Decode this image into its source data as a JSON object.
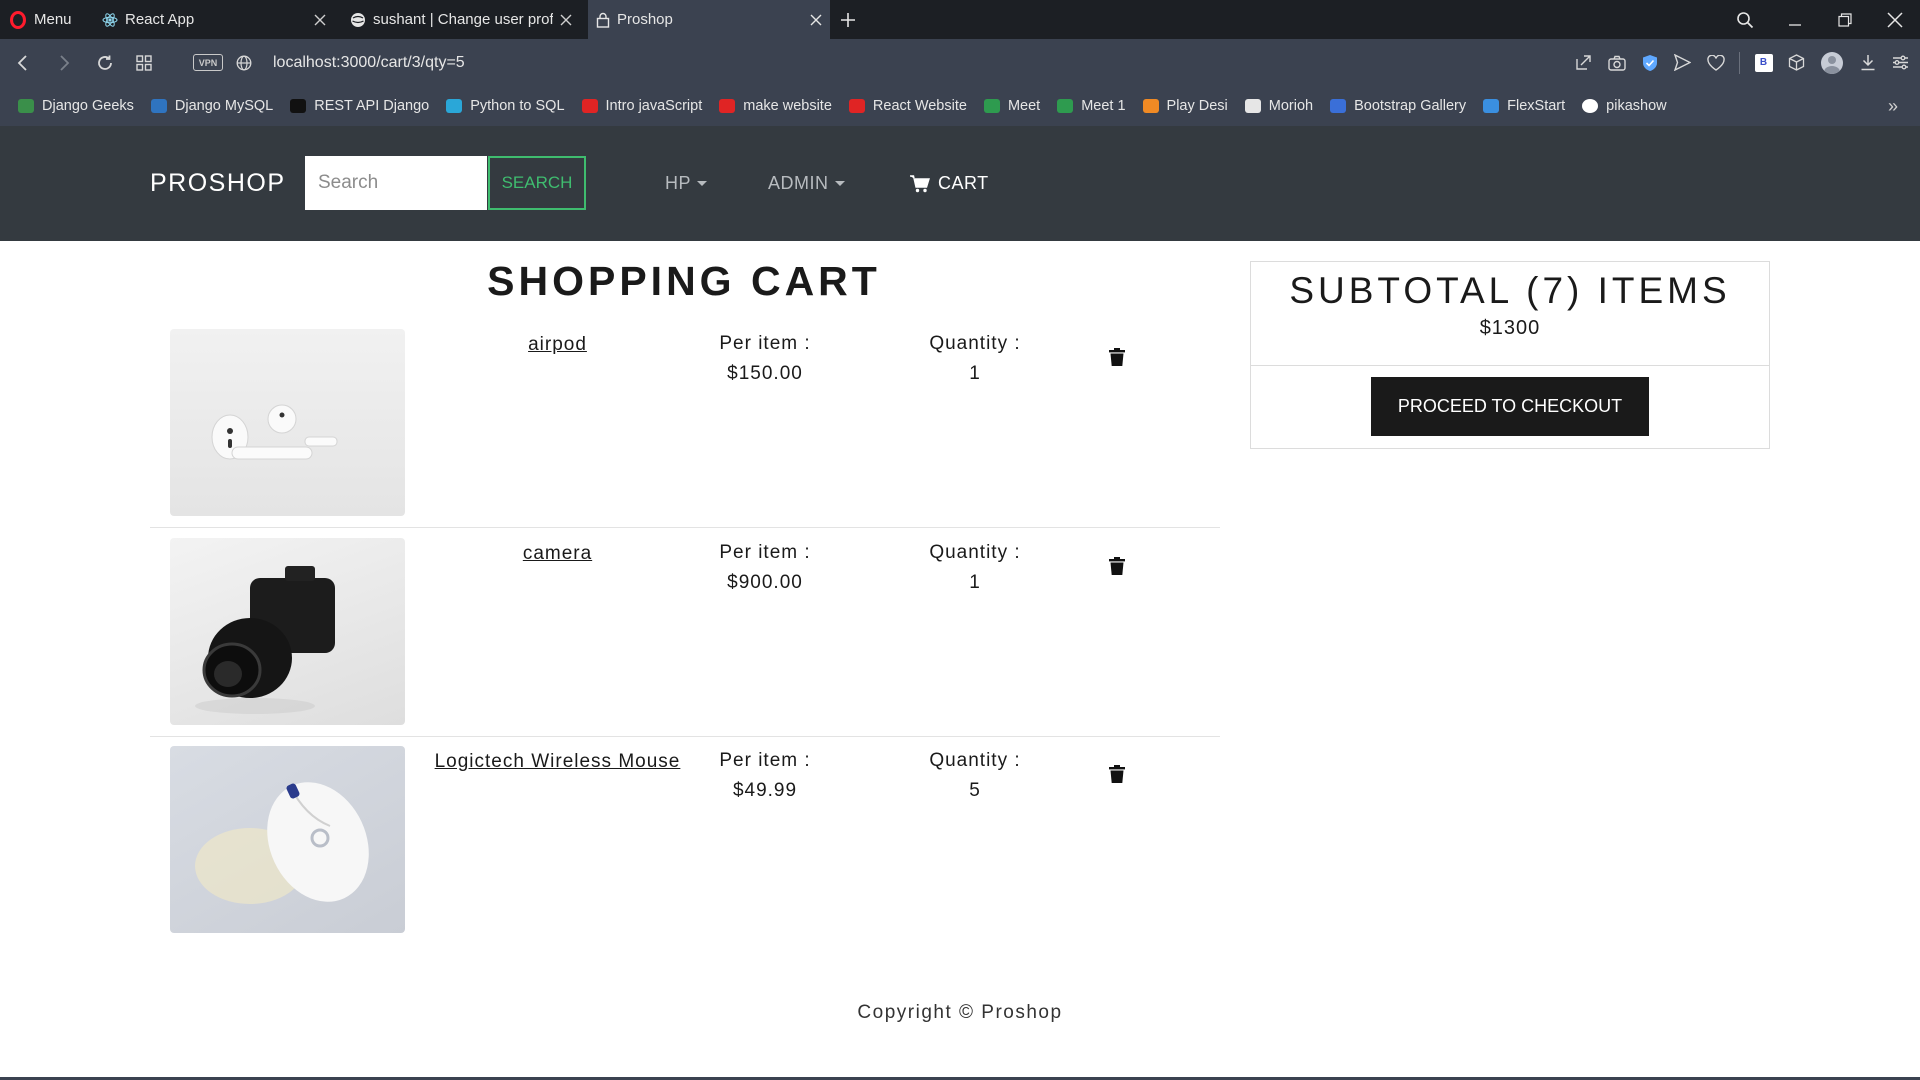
{
  "browser": {
    "menu_label": "Menu",
    "tabs": [
      {
        "title": "React App"
      },
      {
        "title": "sushant | Change user prof"
      },
      {
        "title": "Proshop"
      }
    ],
    "vpn_label": "VPN",
    "url": "localhost:3000/cart/3/qty=5",
    "bookmarks": [
      {
        "label": "Django Geeks",
        "color": "#3a8f4a"
      },
      {
        "label": "Django MySQL",
        "color": "#2f74c0"
      },
      {
        "label": "REST API Django",
        "color": "#111111"
      },
      {
        "label": "Python to SQL",
        "color": "#2aa7d8"
      },
      {
        "label": "Intro javaScript",
        "color": "#e02424"
      },
      {
        "label": "make website",
        "color": "#e02424"
      },
      {
        "label": "React Website",
        "color": "#e02424"
      },
      {
        "label": "Meet",
        "color": "#2e9b4f"
      },
      {
        "label": "Meet 1",
        "color": "#2e9b4f"
      },
      {
        "label": "Play Desi",
        "color": "#f08a24"
      },
      {
        "label": "Morioh",
        "color": "#e6e6e6"
      },
      {
        "label": "Bootstrap Gallery",
        "color": "#3a6fd8"
      },
      {
        "label": "FlexStart",
        "color": "#3a8fe0"
      },
      {
        "label": "pikashow",
        "color": "#ffffff"
      }
    ]
  },
  "navbar": {
    "brand": "PROSHOP",
    "search_placeholder": "Search",
    "search_button": "SEARCH",
    "user_menu": "HP",
    "admin_menu": "ADMIN",
    "cart_link": "CART"
  },
  "cart": {
    "title": "SHOPPING CART",
    "per_item_label": "Per item :",
    "quantity_label": "Quantity :",
    "items": [
      {
        "name": "airpod",
        "price": "$150.00",
        "qty": "1"
      },
      {
        "name": "camera",
        "price": "$900.00",
        "qty": "1"
      },
      {
        "name": "Logictech Wireless Mouse",
        "price": "$49.99",
        "qty": "5"
      }
    ]
  },
  "summary": {
    "title": "SUBTOTAL (7) ITEMS",
    "amount": "$1300",
    "checkout_button": "PROCEED TO CHECKOUT"
  },
  "footer": {
    "copyright": "Copyright © Proshop"
  },
  "colors": {
    "navbar_bg": "#343a40",
    "accent_green": "#3fbc6f",
    "button_dark": "#1a1a1a"
  }
}
